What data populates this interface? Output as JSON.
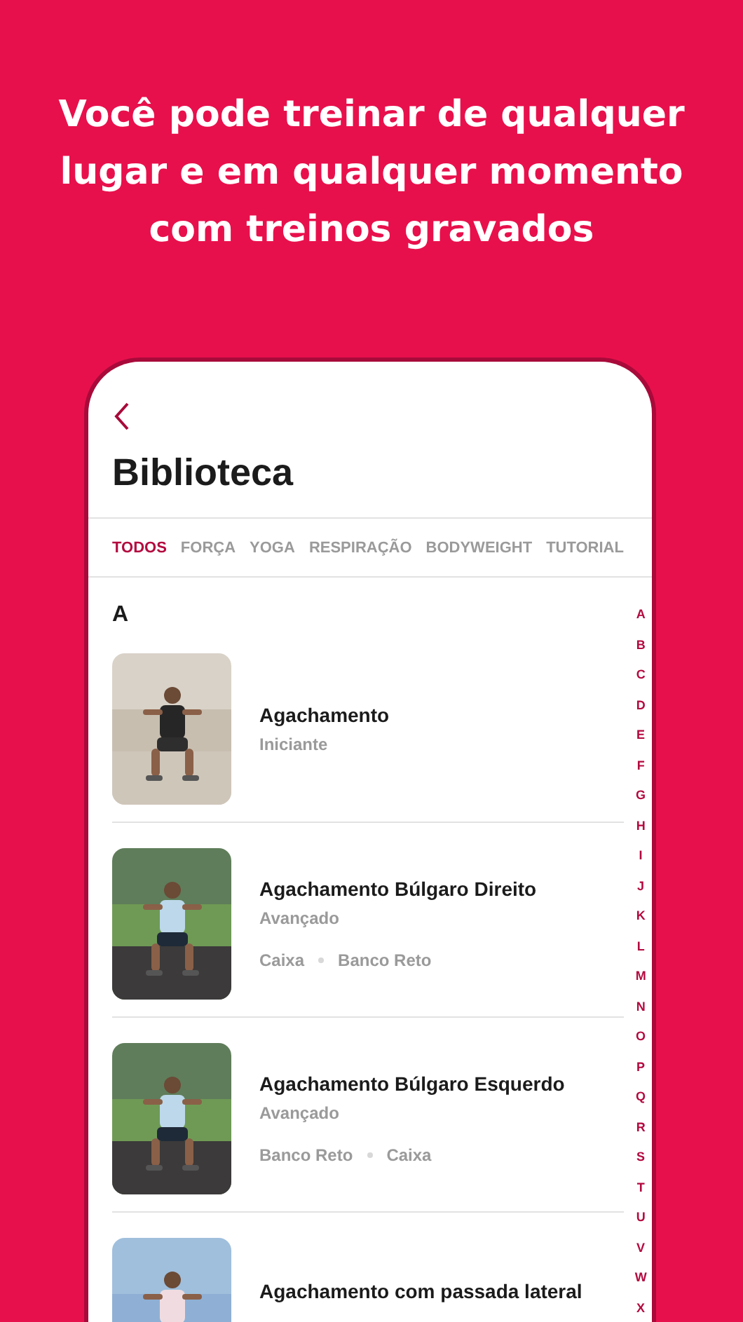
{
  "headline": "Você pode treinar de qualquer lugar e em qualquer momento com treinos gravados",
  "screen": {
    "title": "Biblioteca",
    "tabs": [
      {
        "label": "TODOS",
        "selected": true
      },
      {
        "label": "FORÇA",
        "selected": false
      },
      {
        "label": "YOGA",
        "selected": false
      },
      {
        "label": "RESPIRAÇÃO",
        "selected": false
      },
      {
        "label": "BODYWEIGHT",
        "selected": false
      },
      {
        "label": "TUTORIAL",
        "selected": false
      }
    ],
    "section": "A",
    "exercises": [
      {
        "name": "Agachamento",
        "level": "Iniciante"
      },
      {
        "name": "Agachamento Búlgaro Direito",
        "level": "Avançado",
        "equipment": [
          "Caixa",
          "Banco Reto"
        ]
      },
      {
        "name": "Agachamento Búlgaro Esquerdo",
        "level": "Avançado",
        "equipment": [
          "Banco Reto",
          "Caixa"
        ]
      },
      {
        "name": "Agachamento com passada lateral"
      }
    ],
    "index": [
      "A",
      "B",
      "C",
      "D",
      "E",
      "F",
      "G",
      "H",
      "I",
      "J",
      "K",
      "L",
      "M",
      "N",
      "O",
      "P",
      "Q",
      "R",
      "S",
      "T",
      "U",
      "V",
      "W",
      "X"
    ]
  }
}
